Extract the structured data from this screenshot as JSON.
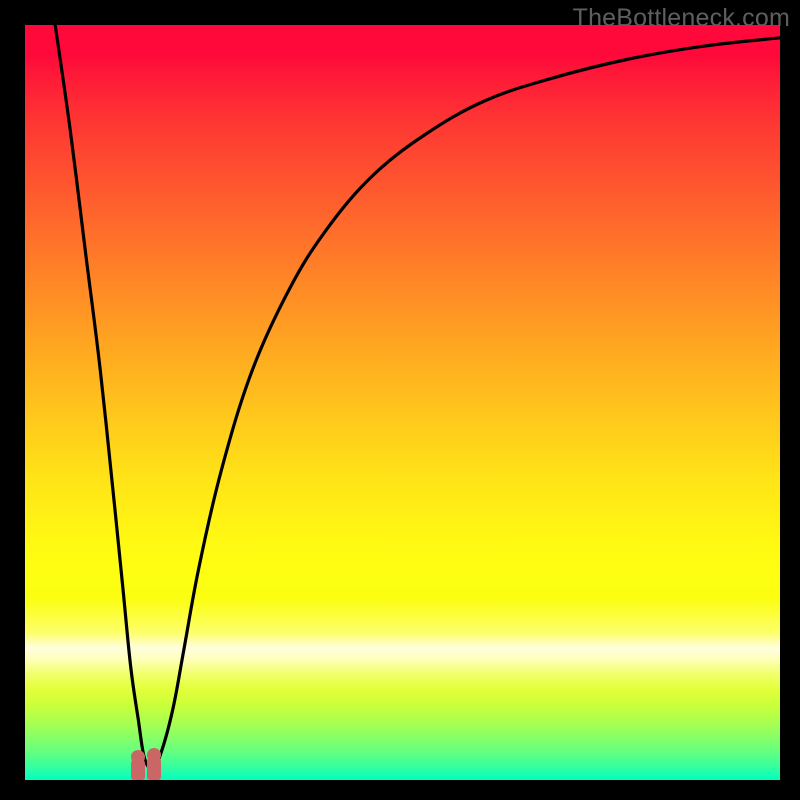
{
  "watermark": "TheBottleneck.com",
  "chart_data": {
    "type": "line",
    "title": "",
    "xlabel": "",
    "ylabel": "",
    "xlim": [
      0,
      100
    ],
    "ylim": [
      0,
      100
    ],
    "grid": false,
    "legend": false,
    "series": [
      {
        "name": "bottleneck-curve",
        "x": [
          4,
          6,
          8,
          10,
          12,
          13,
          14,
          15,
          15.8,
          16.8,
          17.8,
          19.5,
          21,
          23,
          26,
          30,
          35,
          40,
          46,
          53,
          61,
          70,
          80,
          90,
          100
        ],
        "y": [
          100,
          86,
          70,
          54,
          35,
          25,
          15,
          8,
          3,
          1.5,
          3,
          9,
          17,
          28,
          41,
          54,
          65,
          73,
          80,
          85.5,
          90,
          93,
          95.5,
          97.2,
          98.3
        ]
      }
    ],
    "markers": [
      {
        "name": "left-bump",
        "x": 15.0,
        "y": 3.0,
        "height": 3.0
      },
      {
        "name": "right-bump",
        "x": 17.1,
        "y": 3.3,
        "height": 3.3
      }
    ],
    "gradient_stops": [
      {
        "pct": 0,
        "color": "#fe093a"
      },
      {
        "pct": 25,
        "color": "#ff6a2b"
      },
      {
        "pct": 50,
        "color": "#ffc21d"
      },
      {
        "pct": 72,
        "color": "#fffe12"
      },
      {
        "pct": 82,
        "color": "#fefee0"
      },
      {
        "pct": 90,
        "color": "#cbff39"
      },
      {
        "pct": 100,
        "color": "#04febf"
      }
    ]
  }
}
